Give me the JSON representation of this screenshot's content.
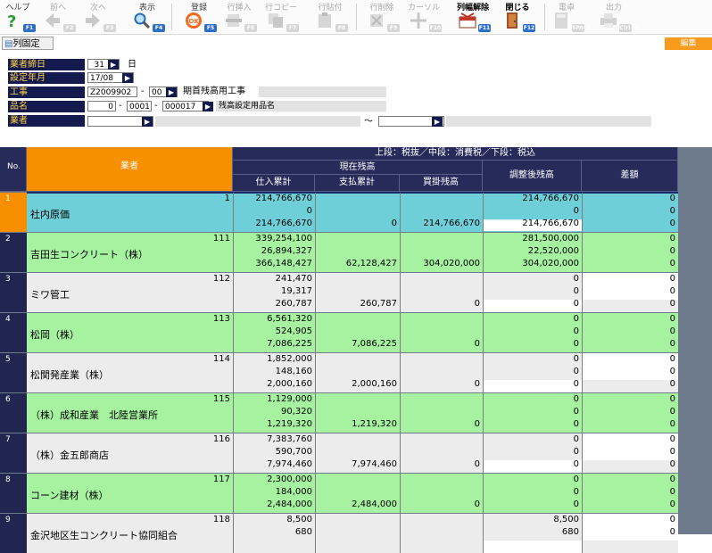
{
  "toolbar": [
    {
      "label": "ヘルプ",
      "fkey": "F1",
      "icon": "help-icon",
      "enabled": true
    },
    {
      "label": "前へ",
      "fkey": "F2",
      "icon": "arrow-left-icon",
      "enabled": false
    },
    {
      "label": "次へ",
      "fkey": "F3",
      "icon": "arrow-right-icon",
      "enabled": false
    },
    {
      "label": "表示",
      "fkey": "F4",
      "icon": "search-icon",
      "enabled": true
    },
    {
      "label": "登録",
      "fkey": "F5",
      "icon": "ok-icon",
      "enabled": true
    },
    {
      "label": "行挿入",
      "fkey": "F6",
      "icon": "insert-row-icon",
      "enabled": false
    },
    {
      "label": "行コピー",
      "fkey": "F7",
      "icon": "copy-row-icon",
      "enabled": false
    },
    {
      "label": "行貼付",
      "fkey": "F8",
      "icon": "paste-row-icon",
      "enabled": false
    },
    {
      "label": "行削除",
      "fkey": "F9",
      "icon": "delete-row-icon",
      "enabled": false
    },
    {
      "label": "カーソル",
      "fkey": "F10",
      "icon": "cursor-icon",
      "enabled": false
    },
    {
      "label": "列幅解除",
      "fkey": "F11",
      "icon": "column-width-icon",
      "enabled": true
    },
    {
      "label": "閉じる",
      "fkey": "F12",
      "icon": "door-icon",
      "enabled": true
    },
    {
      "label": "電卓",
      "fkey": "SPACE",
      "icon": "calculator-icon",
      "enabled": false
    },
    {
      "label": "出力",
      "fkey": "Ctrl+P",
      "icon": "printer-icon",
      "enabled": false
    }
  ],
  "lock_columns_label": "列固定",
  "edit_button": "編集",
  "form": {
    "closing_day_label": "業者締日",
    "closing_day": "31",
    "closing_day_unit": "日",
    "year_month_label": "設定年月",
    "year_month": "17/08",
    "project_label": "工事",
    "project_code": "Z2009902",
    "project_sub": "00",
    "project_name": "期首残高用工事",
    "item_label": "品名",
    "item_code1": "0",
    "item_code2": "0001",
    "item_code3": "000017",
    "item_name": "残高設定用品名",
    "vendor_label": "業者",
    "range_sep": "～"
  },
  "grid": {
    "tax_header": "上段：税抜／中段：消費税／下段：税込",
    "col_no": "No.",
    "col_vendor": "業者",
    "col_current": "現在残高",
    "col_purchase": "仕入累計",
    "col_paid": "支払累計",
    "col_payable": "買掛残高",
    "col_adjusted": "調整後残高",
    "col_diff": "差額",
    "rows": [
      {
        "no": "1",
        "code": "1",
        "name": "社内原価",
        "bg": "#6fcfd8",
        "purchase": [
          "214,766,670",
          "0",
          "214,766,670"
        ],
        "paid": "0",
        "payable": "214,766,670",
        "adjusted": [
          "214,766,670",
          "0",
          "214,766,670"
        ],
        "diff": [
          "0",
          "0",
          "0"
        ],
        "selected": true
      },
      {
        "no": "2",
        "code": "111",
        "name": "吉田生コンクリート（株）",
        "bg": "#a6f2a0",
        "purchase": [
          "339,254,100",
          "26,894,327",
          "366,148,427"
        ],
        "paid": "62,128,427",
        "payable": "304,020,000",
        "adjusted": [
          "281,500,000",
          "22,520,000",
          "304,020,000"
        ],
        "diff": [
          "0",
          "0",
          "0"
        ]
      },
      {
        "no": "3",
        "code": "112",
        "name": "ミワ管工",
        "bg": "#ececec",
        "purchase": [
          "241,470",
          "19,317",
          "260,787"
        ],
        "paid": "260,787",
        "payable": "0",
        "adjusted": [
          "0",
          "0",
          "0"
        ],
        "diff": [
          "0",
          "0",
          "0"
        ]
      },
      {
        "no": "4",
        "code": "113",
        "name": "松岡（株）",
        "bg": "#a6f2a0",
        "purchase": [
          "6,561,320",
          "524,905",
          "7,086,225"
        ],
        "paid": "7,086,225",
        "payable": "0",
        "adjusted": [
          "0",
          "0",
          "0"
        ],
        "diff": [
          "0",
          "0",
          "0"
        ]
      },
      {
        "no": "5",
        "code": "114",
        "name": "松関発産業（株）",
        "bg": "#ececec",
        "purchase": [
          "1,852,000",
          "148,160",
          "2,000,160"
        ],
        "paid": "2,000,160",
        "payable": "0",
        "adjusted": [
          "0",
          "0",
          "0"
        ],
        "diff": [
          "0",
          "0",
          "0"
        ]
      },
      {
        "no": "6",
        "code": "115",
        "name": "（株）成和産業　北陸営業所",
        "bg": "#a6f2a0",
        "purchase": [
          "1,129,000",
          "90,320",
          "1,219,320"
        ],
        "paid": "1,219,320",
        "payable": "0",
        "adjusted": [
          "0",
          "0",
          "0"
        ],
        "diff": [
          "0",
          "0",
          "0"
        ]
      },
      {
        "no": "7",
        "code": "116",
        "name": "（株）金五郎商店",
        "bg": "#ececec",
        "purchase": [
          "7,383,760",
          "590,700",
          "7,974,460"
        ],
        "paid": "7,974,460",
        "payable": "0",
        "adjusted": [
          "0",
          "0",
          "0"
        ],
        "diff": [
          "0",
          "0",
          "0"
        ]
      },
      {
        "no": "8",
        "code": "117",
        "name": "コーン建材（株）",
        "bg": "#a6f2a0",
        "purchase": [
          "2,300,000",
          "184,000",
          "2,484,000"
        ],
        "paid": "2,484,000",
        "payable": "0",
        "adjusted": [
          "0",
          "0",
          "0"
        ],
        "diff": [
          "0",
          "0",
          "0"
        ]
      },
      {
        "no": "9",
        "code": "118",
        "name": "金沢地区生コンクリート協同組合",
        "bg": "#ececec",
        "purchase": [
          "8,500",
          "680",
          ""
        ],
        "paid": "",
        "payable": "",
        "adjusted": [
          "8,500",
          "680",
          ""
        ],
        "diff": [
          "0",
          "0",
          ""
        ]
      }
    ]
  },
  "colors": {
    "header_navy": "#262b5a",
    "header_orange": "#f88f00",
    "label_navy": "#141a4e",
    "label_text": "#ffd24a",
    "row_cyan": "#6fcfd8",
    "row_green": "#a6f2a0",
    "row_gray": "#ececec"
  }
}
